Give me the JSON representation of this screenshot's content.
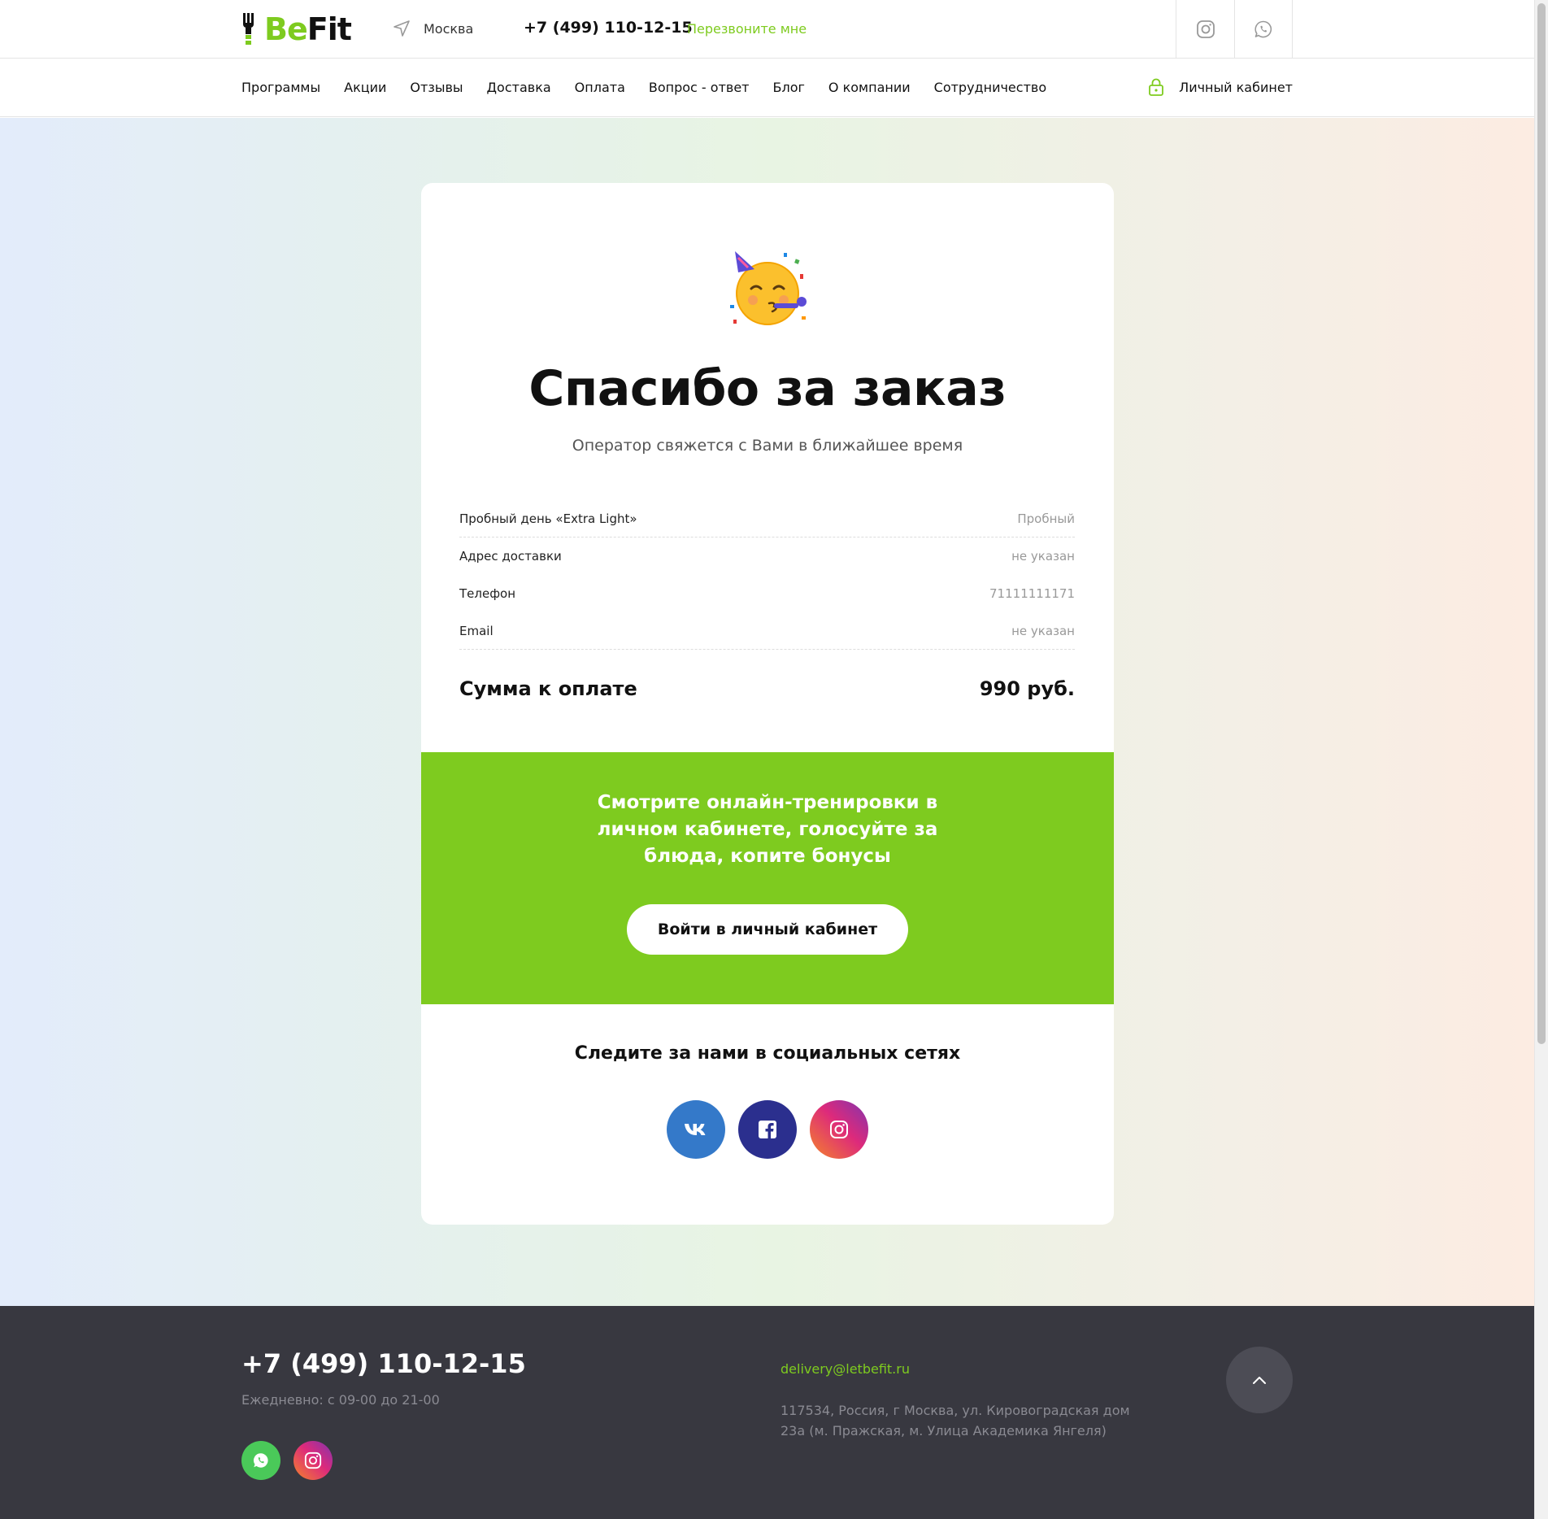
{
  "header": {
    "logo_be": "Be",
    "logo_fit": "Fit",
    "city": "Москва",
    "phone": "+7 (499) 110-12-15",
    "callback": "Перезвоните мне",
    "icons": [
      "instagram-icon",
      "whatsapp-icon"
    ]
  },
  "nav": {
    "items": [
      "Программы",
      "Акции",
      "Отзывы",
      "Доставка",
      "Оплата",
      "Вопрос - ответ",
      "Блог",
      "О компании",
      "Сотрудничество"
    ],
    "account": "Личный кабинет"
  },
  "order": {
    "title": "Спасибо за заказ",
    "subtitle": "Оператор свяжется с Вами в ближайшее время",
    "rows": [
      {
        "label": "Пробный день «Extra Light»",
        "value": "Пробный"
      },
      {
        "label": "Адрес доставки",
        "value": "не указан"
      },
      {
        "label": "Телефон",
        "value": "71111111171"
      },
      {
        "label": "Email",
        "value": "не указан"
      }
    ],
    "total_label": "Сумма к оплате",
    "total_value": "990 руб."
  },
  "promo": {
    "text": "Смотрите онлайн-тренировки в личном кабинете, голосуйте за блюда, копите бонусы",
    "button": "Войти в личный кабинет"
  },
  "follow": {
    "title": "Следите за нами в социальных сетях",
    "icons": [
      "vk-icon",
      "facebook-icon",
      "instagram-icon"
    ]
  },
  "footer": {
    "phone": "+7 (499) 110-12-15",
    "hours": "Ежедневно: с 09-00 до 21-00",
    "email": "delivery@letbefit.ru",
    "address": "117534, Россия, г Москва, ул. Кировоградская дом 23а (м. Пражская, м. Улица Академика Янгеля)"
  },
  "colors": {
    "accent": "#7ecb1f",
    "footer_bg": "#383840",
    "vk": "#3479c9",
    "facebook": "#2b2f8e"
  }
}
